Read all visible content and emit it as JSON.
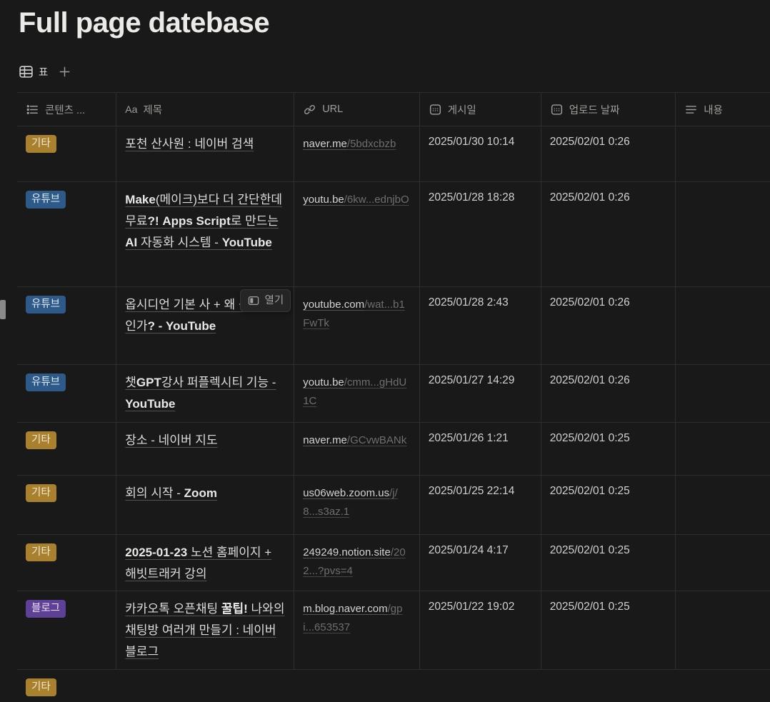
{
  "page": {
    "title": "Full page datebase"
  },
  "view_bar": {
    "active_view": "표",
    "active_view_icon": "table-view-icon",
    "add_view_icon": "plus-icon"
  },
  "colors": {
    "background": "#191919",
    "border": "#2e2e2e",
    "tag_colors": {
      "gold": {
        "bg": "#a9812e",
        "fg": "#f3e9d2"
      },
      "blue": {
        "bg": "#2d5a88",
        "fg": "#e0eaf5"
      },
      "purple": {
        "bg": "#5e4097",
        "fg": "#eae2f7"
      }
    }
  },
  "table": {
    "columns": [
      {
        "icon": "list-icon",
        "label": "콘텐츠 ..."
      },
      {
        "icon": "title-aa-icon",
        "label": "제목"
      },
      {
        "icon": "link-icon",
        "label": "URL"
      },
      {
        "icon": "calendar-icon",
        "label": "게시일"
      },
      {
        "icon": "calendar-icon",
        "label": "업로드 날짜"
      },
      {
        "icon": "text-lines-icon",
        "label": "내용"
      }
    ],
    "rows": [
      {
        "tag": {
          "label": "기타",
          "color": "gold"
        },
        "title": [
          {
            "t": "포천 산사원 : 네이버 검색",
            "b": false
          }
        ],
        "url": {
          "domain": "naver.me",
          "path": "/5bdxcbzb"
        },
        "published": "2025/01/30 10:14",
        "uploaded": "2025/02/01 0:26",
        "content": ""
      },
      {
        "tag": {
          "label": "유튜브",
          "color": "blue"
        },
        "title": [
          {
            "t": "Make",
            "b": true
          },
          {
            "t": "(메이크)보다 더 간단한데 무료",
            "b": false
          },
          {
            "t": "?! Apps Script",
            "b": true
          },
          {
            "t": "로 만드는 ",
            "b": false
          },
          {
            "t": "AI",
            "b": true
          },
          {
            "t": " 자동화 시스템 - ",
            "b": false
          },
          {
            "t": "YouTube",
            "b": true
          }
        ],
        "url": {
          "domain": "youtu.be",
          "path": "/6kw...ednjbO"
        },
        "published": "2025/01/28 18:28",
        "uploaded": "2025/02/01 0:26",
        "content": ""
      },
      {
        "tag": {
          "label": "유튜브",
          "color": "blue"
        },
        "title": [
          {
            "t": "옵시디언 기본 사 + 왜 옵시디언인가",
            "b": false
          },
          {
            "t": "? - YouTube",
            "b": true
          }
        ],
        "url": {
          "domain": "youtube.com",
          "path": "/wat...b1FwTk"
        },
        "published": "2025/01/28 2:43",
        "uploaded": "2025/02/01 0:26",
        "content": "",
        "hover_button": {
          "icon": "side-peek-icon",
          "label": "열기"
        }
      },
      {
        "tag": {
          "label": "유튜브",
          "color": "blue"
        },
        "title": [
          {
            "t": "챗",
            "b": false
          },
          {
            "t": "GPT",
            "b": true
          },
          {
            "t": "강사 퍼플렉시티 기능 - ",
            "b": false
          },
          {
            "t": "YouTube",
            "b": true
          }
        ],
        "url": {
          "domain": "youtu.be",
          "path": "/cmm...gHdU1C"
        },
        "published": "2025/01/27 14:29",
        "uploaded": "2025/02/01 0:26",
        "content": ""
      },
      {
        "tag": {
          "label": "기타",
          "color": "gold"
        },
        "title": [
          {
            "t": "장소 - 네이버 지도",
            "b": false
          }
        ],
        "url": {
          "domain": "naver.me",
          "path": "/GCvwBANk"
        },
        "published": "2025/01/26 1:21",
        "uploaded": "2025/02/01 0:25",
        "content": ""
      },
      {
        "tag": {
          "label": "기타",
          "color": "gold"
        },
        "title": [
          {
            "t": "회의 시작 - ",
            "b": false
          },
          {
            "t": "Zoom",
            "b": true
          }
        ],
        "url": {
          "domain": "us06web.zoom.us",
          "path": "/j/8...s3az.1"
        },
        "published": "2025/01/25 22:14",
        "uploaded": "2025/02/01 0:25",
        "content": ""
      },
      {
        "tag": {
          "label": "기타",
          "color": "gold"
        },
        "title": [
          {
            "t": "2025-01-23",
            "b": true
          },
          {
            "t": " 노션 홈페이지 + 해빗트래커 강의",
            "b": false
          }
        ],
        "url": {
          "domain": "249249.notion.site",
          "path": "/202...?pvs=4"
        },
        "published": "2025/01/24 4:17",
        "uploaded": "2025/02/01 0:25",
        "content": ""
      },
      {
        "tag": {
          "label": "블로그",
          "color": "purple"
        },
        "title": [
          {
            "t": "카카오톡 오픈채팅 ",
            "b": false
          },
          {
            "t": "꿀팁!",
            "b": true
          },
          {
            "t": " 나와의 채팅방 여러개 만들기 : 네이버 블로그",
            "b": false
          }
        ],
        "url": {
          "domain": "m.blog.naver.com",
          "path": "/gpi...653537"
        },
        "published": "2025/01/22 19:02",
        "uploaded": "2025/02/01 0:25",
        "content": ""
      }
    ],
    "partial_row": {
      "tag": {
        "label": "기타",
        "color": "gold"
      }
    }
  }
}
